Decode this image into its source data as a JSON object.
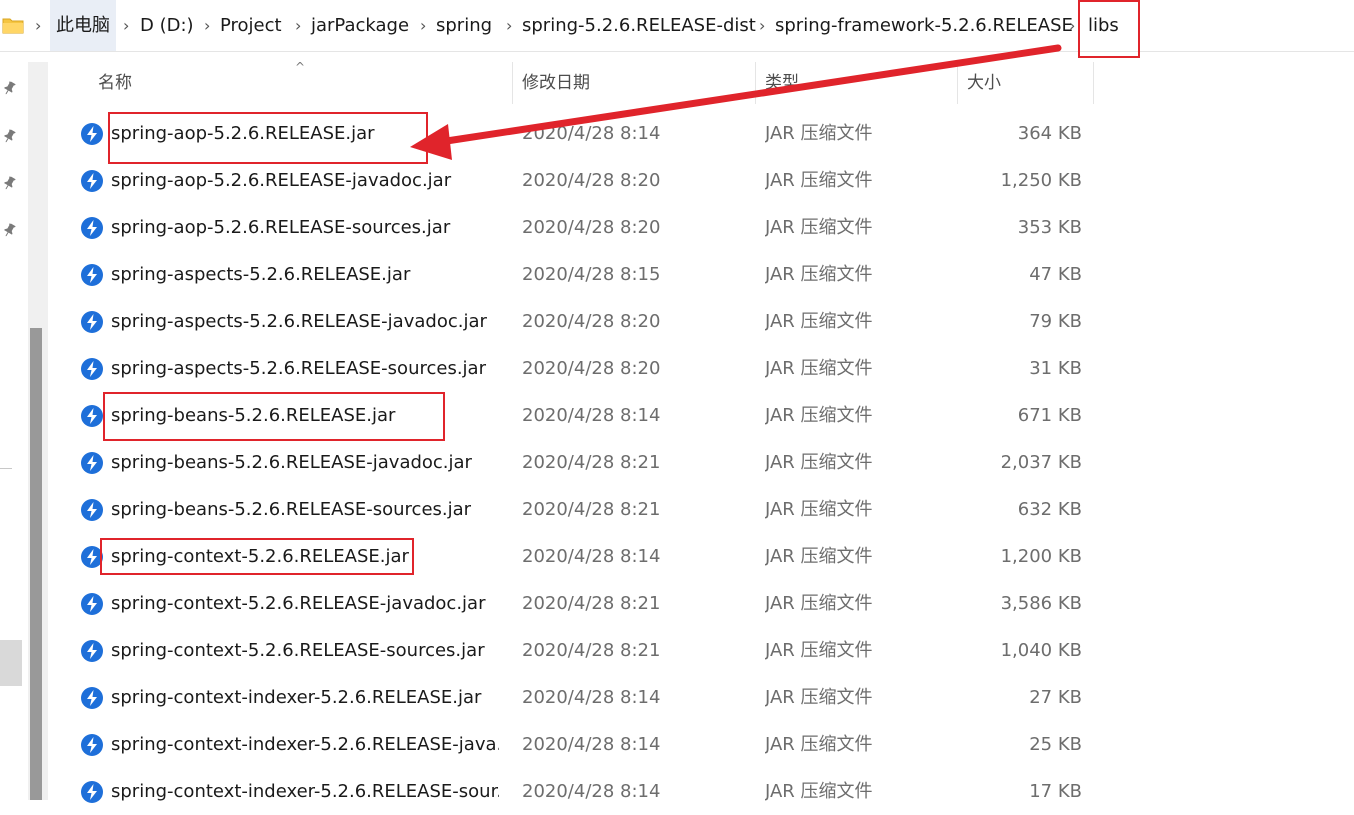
{
  "breadcrumb": {
    "items": [
      "此电脑",
      "D (D:)",
      "Project",
      "jarPackage",
      "spring",
      "spring-5.2.6.RELEASE-dist",
      "spring-framework-5.2.6.RELEASE",
      "libs"
    ],
    "separator": "›"
  },
  "columns": {
    "name": "名称",
    "date": "修改日期",
    "type": "类型",
    "size": "大小"
  },
  "files": [
    {
      "name": "spring-aop-5.2.6.RELEASE.jar",
      "date": "2020/4/28 8:14",
      "type": "JAR 压缩文件",
      "size": "364 KB"
    },
    {
      "name": "spring-aop-5.2.6.RELEASE-javadoc.jar",
      "date": "2020/4/28 8:20",
      "type": "JAR 压缩文件",
      "size": "1,250 KB"
    },
    {
      "name": "spring-aop-5.2.6.RELEASE-sources.jar",
      "date": "2020/4/28 8:20",
      "type": "JAR 压缩文件",
      "size": "353 KB"
    },
    {
      "name": "spring-aspects-5.2.6.RELEASE.jar",
      "date": "2020/4/28 8:15",
      "type": "JAR 压缩文件",
      "size": "47 KB"
    },
    {
      "name": "spring-aspects-5.2.6.RELEASE-javadoc.jar",
      "date": "2020/4/28 8:20",
      "type": "JAR 压缩文件",
      "size": "79 KB"
    },
    {
      "name": "spring-aspects-5.2.6.RELEASE-sources.jar",
      "date": "2020/4/28 8:20",
      "type": "JAR 压缩文件",
      "size": "31 KB"
    },
    {
      "name": "spring-beans-5.2.6.RELEASE.jar",
      "date": "2020/4/28 8:14",
      "type": "JAR 压缩文件",
      "size": "671 KB"
    },
    {
      "name": "spring-beans-5.2.6.RELEASE-javadoc.jar",
      "date": "2020/4/28 8:21",
      "type": "JAR 压缩文件",
      "size": "2,037 KB"
    },
    {
      "name": "spring-beans-5.2.6.RELEASE-sources.jar",
      "date": "2020/4/28 8:21",
      "type": "JAR 压缩文件",
      "size": "632 KB"
    },
    {
      "name": "spring-context-5.2.6.RELEASE.jar",
      "date": "2020/4/28 8:14",
      "type": "JAR 压缩文件",
      "size": "1,200 KB"
    },
    {
      "name": "spring-context-5.2.6.RELEASE-javadoc.jar",
      "date": "2020/4/28 8:21",
      "type": "JAR 压缩文件",
      "size": "3,586 KB"
    },
    {
      "name": "spring-context-5.2.6.RELEASE-sources.jar",
      "date": "2020/4/28 8:21",
      "type": "JAR 压缩文件",
      "size": "1,040 KB"
    },
    {
      "name": "spring-context-indexer-5.2.6.RELEASE.jar",
      "date": "2020/4/28 8:14",
      "type": "JAR 压缩文件",
      "size": "27 KB"
    },
    {
      "name": "spring-context-indexer-5.2.6.RELEASE-java...",
      "date": "2020/4/28 8:14",
      "type": "JAR 压缩文件",
      "size": "25 KB"
    },
    {
      "name": "spring-context-indexer-5.2.6.RELEASE-sour...",
      "date": "2020/4/28 8:14",
      "type": "JAR 压缩文件",
      "size": "17 KB"
    }
  ],
  "colors": {
    "annotation_red": "#e0242b",
    "jar_icon_blue": "#1e6fd9"
  },
  "icons": {
    "file": "jar-file-icon",
    "folder": "folder-icon",
    "pin": "pin-icon"
  }
}
